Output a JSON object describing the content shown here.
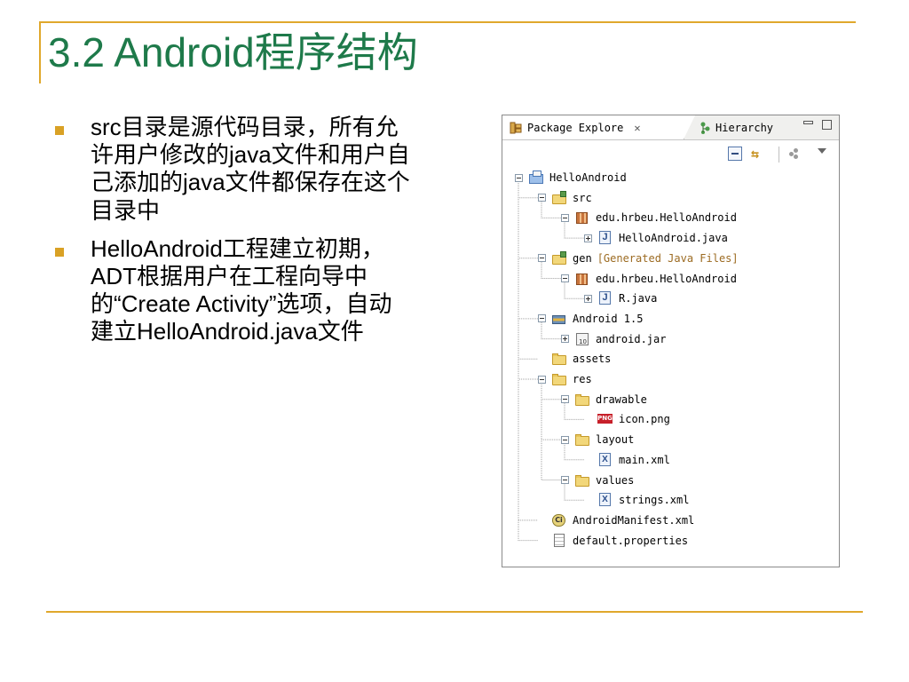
{
  "slide": {
    "title": "3.2  Android程序结构",
    "bullets": [
      "src目录是源代码目录，所有允许用户修改的java文件和用户自己添加的java文件都保存在这个目录中",
      "HelloAndroid工程建立初期，ADT根据用户在工程向导中的“Create Activity”选项，自动建立HelloAndroid.java文件"
    ]
  },
  "explorer": {
    "tabs": [
      {
        "label": "Package Explore",
        "icon": "package-explorer-icon",
        "active": true
      },
      {
        "label": "Hierarchy",
        "icon": "hierarchy-icon",
        "active": false
      }
    ],
    "toolbar": [
      "collapse-all-icon",
      "link-with-editor-icon",
      "menu-icon",
      "view-menu-icon"
    ],
    "tree": [
      {
        "label": "HelloAndroid",
        "depth": 0,
        "toggle": "minus",
        "icon": "android-project-icon"
      },
      {
        "label": "src",
        "depth": 1,
        "toggle": "minus",
        "icon": "source-folder-icon"
      },
      {
        "label": "edu.hrbeu.HelloAndroid",
        "depth": 2,
        "toggle": "minus",
        "icon": "package-icon"
      },
      {
        "label": "HelloAndroid.java",
        "depth": 3,
        "toggle": "plus",
        "icon": "java-file-icon"
      },
      {
        "label": "gen",
        "suffix": "[Generated Java Files]",
        "depth": 1,
        "toggle": "minus",
        "icon": "generated-folder-icon"
      },
      {
        "label": "edu.hrbeu.HelloAndroid",
        "depth": 2,
        "toggle": "minus",
        "icon": "package-icon"
      },
      {
        "label": "R.java",
        "depth": 3,
        "toggle": "plus",
        "icon": "java-file-icon"
      },
      {
        "label": "Android 1.5",
        "depth": 1,
        "toggle": "minus",
        "icon": "library-icon"
      },
      {
        "label": "android.jar",
        "depth": 2,
        "toggle": "plus",
        "icon": "jar-icon"
      },
      {
        "label": "assets",
        "depth": 1,
        "toggle": "none",
        "icon": "folder-icon"
      },
      {
        "label": "res",
        "depth": 1,
        "toggle": "minus",
        "icon": "folder-icon"
      },
      {
        "label": "drawable",
        "depth": 2,
        "toggle": "minus",
        "icon": "folder-icon"
      },
      {
        "label": "icon.png",
        "depth": 3,
        "toggle": "none",
        "icon": "png-file-icon"
      },
      {
        "label": "layout",
        "depth": 2,
        "toggle": "minus",
        "icon": "folder-icon"
      },
      {
        "label": "main.xml",
        "depth": 3,
        "toggle": "none",
        "icon": "xml-file-icon"
      },
      {
        "label": "values",
        "depth": 2,
        "toggle": "minus",
        "icon": "folder-icon"
      },
      {
        "label": "strings.xml",
        "depth": 3,
        "toggle": "none",
        "icon": "xml-file-icon"
      },
      {
        "label": "AndroidManifest.xml",
        "depth": 1,
        "toggle": "none",
        "icon": "manifest-icon"
      },
      {
        "label": "default.properties",
        "depth": 1,
        "toggle": "none",
        "icon": "properties-file-icon"
      }
    ]
  },
  "colors": {
    "title": "#1e7a4a",
    "accent_rule": "#e0a82c",
    "bullet": "#d9a125",
    "generated_suffix": "#9c6b22"
  }
}
